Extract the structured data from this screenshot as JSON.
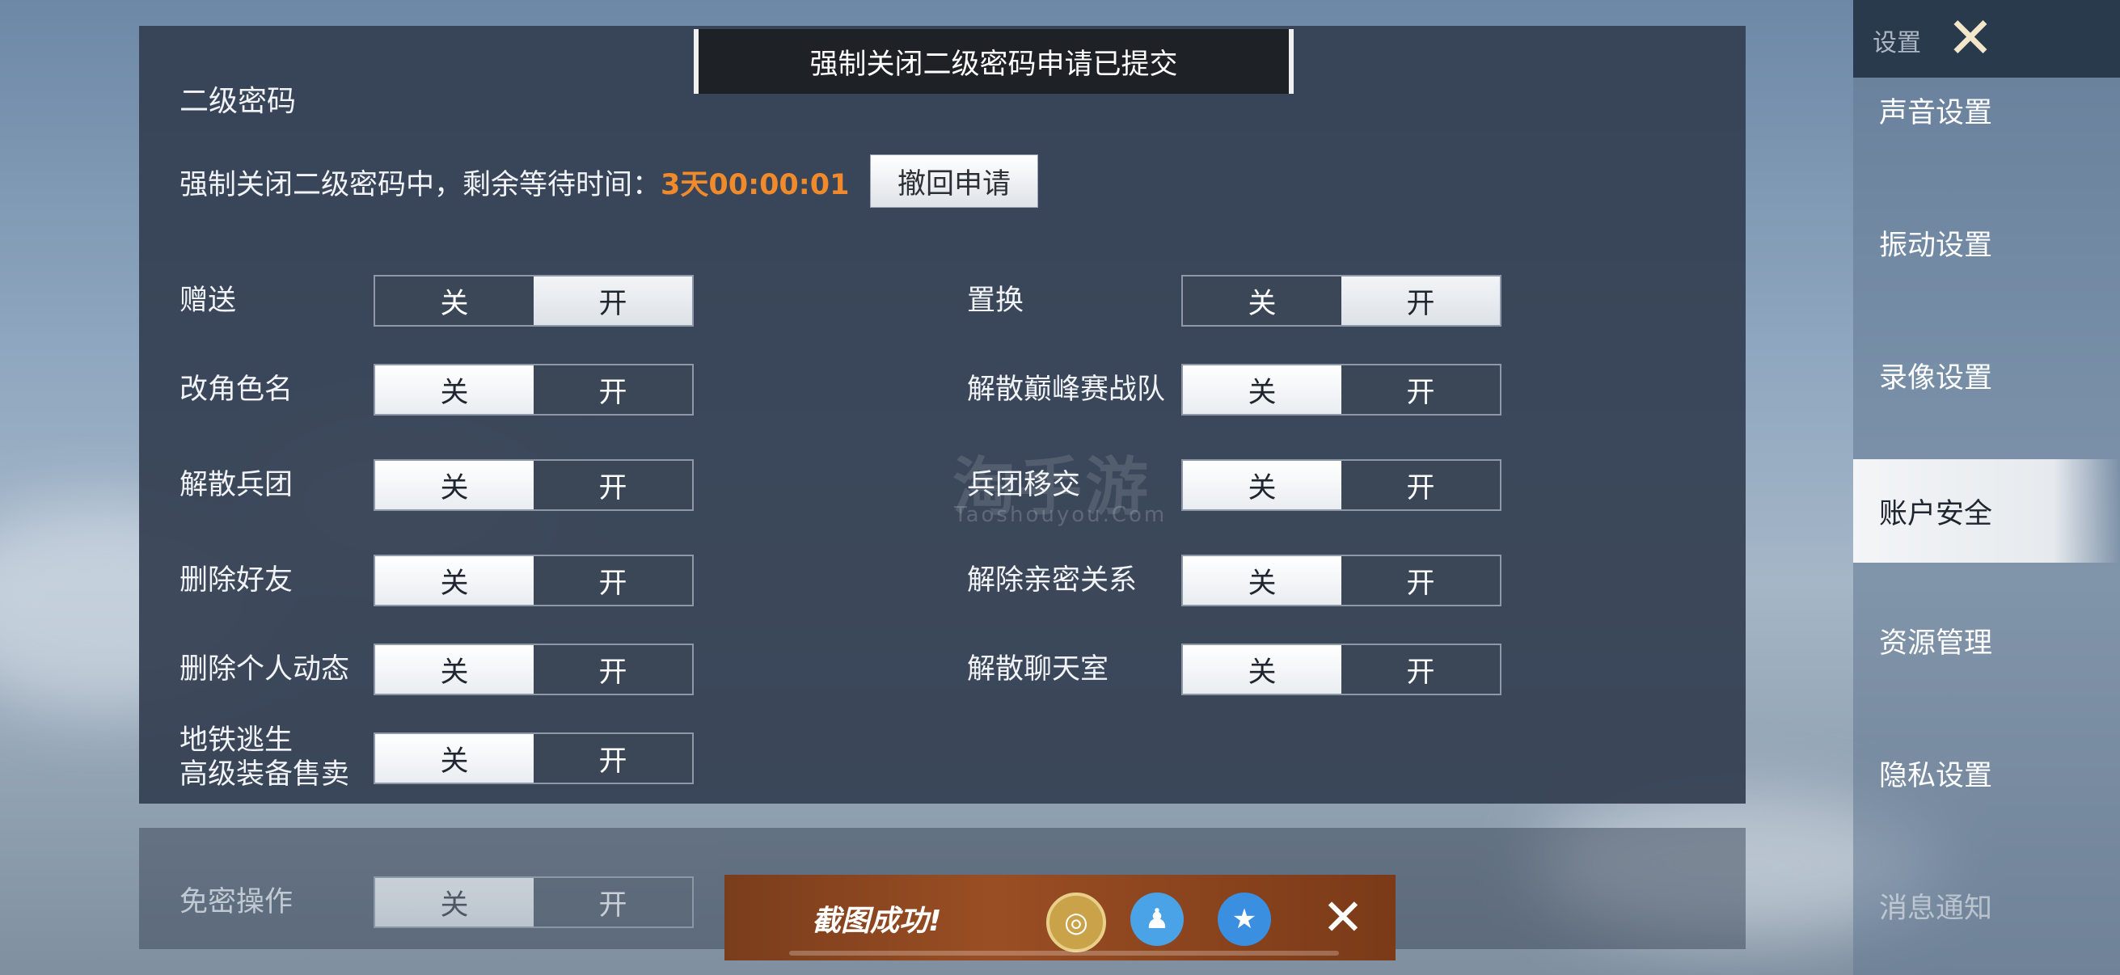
{
  "section_title": "二级密码",
  "toast": "强制关闭二级密码申请已提交",
  "status": {
    "prefix": "强制关闭二级密码中，剩余等待时间：",
    "countdown": "3天00:00:01",
    "countdown_color": "#f08a2a"
  },
  "revoke_button": "撤回申请",
  "toggle_labels": {
    "off": "关",
    "on": "开"
  },
  "rows": {
    "gift": {
      "label": "赠送",
      "state": "on"
    },
    "exchange": {
      "label": "置换",
      "state": "on"
    },
    "rename": {
      "label": "改角色名",
      "state": "off"
    },
    "disband_team": {
      "label": "解散巅峰赛战队",
      "state": "off"
    },
    "disband_corps": {
      "label": "解散兵团",
      "state": "off"
    },
    "transfer_corps": {
      "label": "兵团移交",
      "state": "off"
    },
    "delete_friend": {
      "label": "删除好友",
      "state": "off"
    },
    "remove_intimacy": {
      "label": "解除亲密关系",
      "state": "off"
    },
    "delete_moments": {
      "label": "删除个人动态",
      "state": "off"
    },
    "disband_chat": {
      "label": "解散聊天室",
      "state": "off"
    },
    "metro_sell": {
      "label_line1": "地铁逃生",
      "label_line2": "高级装备售卖",
      "state": "off"
    }
  },
  "free_pass": {
    "label": "免密操作",
    "state": "off"
  },
  "sidebar": {
    "title": "设置",
    "items": [
      {
        "label": "声音设置"
      },
      {
        "label": "振动设置"
      },
      {
        "label": "录像设置"
      },
      {
        "label": "账户安全",
        "active": true
      },
      {
        "label": "资源管理"
      },
      {
        "label": "隐私设置"
      },
      {
        "label": "消息通知"
      }
    ]
  },
  "watermark": {
    "main": "淘手游",
    "sub": "Taoshouyou.Com"
  },
  "screenshot_bar": {
    "text": "截图成功!",
    "icons": [
      "game-share-icon",
      "qq-icon",
      "qzone-icon"
    ]
  }
}
